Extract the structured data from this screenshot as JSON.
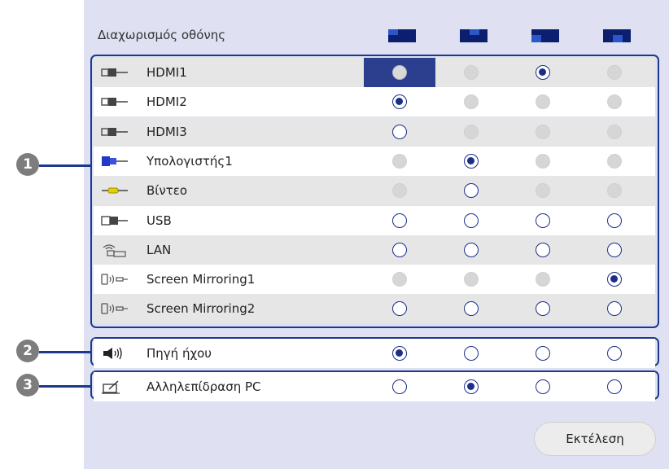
{
  "header": {
    "title": "Διαχωρισμός οθόνης"
  },
  "layout_columns": [
    {
      "icon": "layout-top-left-icon"
    },
    {
      "icon": "layout-top-right-icon"
    },
    {
      "icon": "layout-bottom-left-icon"
    },
    {
      "icon": "layout-bottom-right-icon"
    }
  ],
  "sources": [
    {
      "label": "HDMI1",
      "icon": "hdmi-icon",
      "states": [
        "focus",
        "disabled",
        "checked",
        "disabled"
      ]
    },
    {
      "label": "HDMI2",
      "icon": "hdmi-icon",
      "states": [
        "checked",
        "disabled",
        "disabled",
        "disabled"
      ]
    },
    {
      "label": "HDMI3",
      "icon": "hdmi-icon",
      "states": [
        "unchecked",
        "disabled",
        "disabled",
        "disabled"
      ]
    },
    {
      "label": "Υπολογιστής1",
      "icon": "vga-icon",
      "states": [
        "disabled",
        "checked",
        "disabled",
        "disabled"
      ]
    },
    {
      "label": "Βίντεο",
      "icon": "rca-video-icon",
      "states": [
        "disabled",
        "unchecked",
        "disabled",
        "disabled"
      ]
    },
    {
      "label": "USB",
      "icon": "usb-icon",
      "states": [
        "unchecked",
        "unchecked",
        "unchecked",
        "unchecked"
      ]
    },
    {
      "label": "LAN",
      "icon": "lan-icon",
      "states": [
        "unchecked",
        "unchecked",
        "unchecked",
        "unchecked"
      ]
    },
    {
      "label": "Screen Mirroring1",
      "icon": "screen-mirroring-icon",
      "states": [
        "disabled",
        "disabled",
        "disabled",
        "checked"
      ]
    },
    {
      "label": "Screen Mirroring2",
      "icon": "screen-mirroring-icon",
      "states": [
        "unchecked",
        "unchecked",
        "unchecked",
        "unchecked"
      ]
    }
  ],
  "audio": {
    "label": "Πηγή ήχου",
    "icon": "speaker-icon",
    "states": [
      "checked",
      "unchecked",
      "unchecked",
      "unchecked"
    ]
  },
  "interactive": {
    "label": "Αλληλεπίδραση PC",
    "icon": "pen-board-icon",
    "states": [
      "unchecked",
      "checked",
      "unchecked",
      "unchecked"
    ]
  },
  "callouts": [
    "1",
    "2",
    "3"
  ],
  "actions": {
    "execute_label": "Εκτέλεση"
  },
  "colors": {
    "accent": "#1b3a8e",
    "panel": "#dfe1f3",
    "selected_cell": "#2b3f8e",
    "callout": "#7d7d7d"
  }
}
